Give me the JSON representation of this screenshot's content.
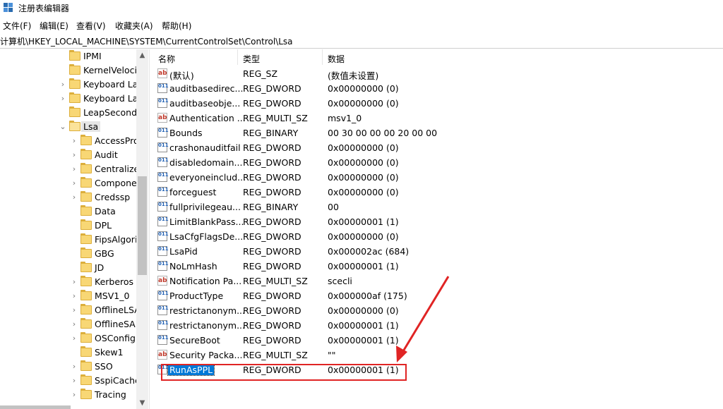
{
  "window": {
    "title": "注册表编辑器"
  },
  "menu": [
    "文件(F)",
    "编辑(E)",
    "查看(V)",
    "收藏夹(A)",
    "帮助(H)"
  ],
  "address": "计算机\\HKEY_LOCAL_MACHINE\\SYSTEM\\CurrentControlSet\\Control\\Lsa",
  "tree": {
    "items": [
      {
        "label": "IPMI",
        "level": 1,
        "expander": "",
        "selected": false
      },
      {
        "label": "KernelVelocit",
        "level": 1,
        "expander": "",
        "selected": false
      },
      {
        "label": "Keyboard Lay",
        "level": 1,
        "expander": ">",
        "selected": false
      },
      {
        "label": "Keyboard Lay",
        "level": 1,
        "expander": ">",
        "selected": false
      },
      {
        "label": "LeapSecondI",
        "level": 1,
        "expander": "",
        "selected": false
      },
      {
        "label": "Lsa",
        "level": 1,
        "expander": "v",
        "selected": true
      },
      {
        "label": "AccessPro",
        "level": 2,
        "expander": ">",
        "selected": false
      },
      {
        "label": "Audit",
        "level": 2,
        "expander": ">",
        "selected": false
      },
      {
        "label": "Centralize",
        "level": 2,
        "expander": ">",
        "selected": false
      },
      {
        "label": "Componer",
        "level": 2,
        "expander": ">",
        "selected": false
      },
      {
        "label": "Credssp",
        "level": 2,
        "expander": ">",
        "selected": false
      },
      {
        "label": "Data",
        "level": 2,
        "expander": "",
        "selected": false
      },
      {
        "label": "DPL",
        "level": 2,
        "expander": "",
        "selected": false
      },
      {
        "label": "FipsAlgori",
        "level": 2,
        "expander": "",
        "selected": false
      },
      {
        "label": "GBG",
        "level": 2,
        "expander": "",
        "selected": false
      },
      {
        "label": "JD",
        "level": 2,
        "expander": "",
        "selected": false
      },
      {
        "label": "Kerberos",
        "level": 2,
        "expander": ">",
        "selected": false
      },
      {
        "label": "MSV1_0",
        "level": 2,
        "expander": ">",
        "selected": false
      },
      {
        "label": "OfflineLSA",
        "level": 2,
        "expander": ">",
        "selected": false
      },
      {
        "label": "OfflineSAM",
        "level": 2,
        "expander": ">",
        "selected": false
      },
      {
        "label": "OSConfig",
        "level": 2,
        "expander": ">",
        "selected": false
      },
      {
        "label": "Skew1",
        "level": 2,
        "expander": "",
        "selected": false
      },
      {
        "label": "SSO",
        "level": 2,
        "expander": ">",
        "selected": false
      },
      {
        "label": "SspiCache",
        "level": 2,
        "expander": ">",
        "selected": false
      },
      {
        "label": "Tracing",
        "level": 2,
        "expander": ">",
        "selected": false
      }
    ]
  },
  "list": {
    "columns": [
      "名称",
      "类型",
      "数据"
    ],
    "rows": [
      {
        "name": "(默认)",
        "type": "REG_SZ",
        "data": "(数值未设置)",
        "icon": "string-value-icon"
      },
      {
        "name": "auditbasedirec...",
        "type": "REG_DWORD",
        "data": "0x00000000 (0)",
        "icon": "binary-value-icon"
      },
      {
        "name": "auditbaseobje...",
        "type": "REG_DWORD",
        "data": "0x00000000 (0)",
        "icon": "binary-value-icon"
      },
      {
        "name": "Authentication ...",
        "type": "REG_MULTI_SZ",
        "data": "msv1_0",
        "icon": "string-value-icon"
      },
      {
        "name": "Bounds",
        "type": "REG_BINARY",
        "data": "00 30 00 00 00 20 00 00",
        "icon": "binary-value-icon"
      },
      {
        "name": "crashonauditfail",
        "type": "REG_DWORD",
        "data": "0x00000000 (0)",
        "icon": "binary-value-icon"
      },
      {
        "name": "disabledomain...",
        "type": "REG_DWORD",
        "data": "0x00000000 (0)",
        "icon": "binary-value-icon"
      },
      {
        "name": "everyoneinclud...",
        "type": "REG_DWORD",
        "data": "0x00000000 (0)",
        "icon": "binary-value-icon"
      },
      {
        "name": "forceguest",
        "type": "REG_DWORD",
        "data": "0x00000000 (0)",
        "icon": "binary-value-icon"
      },
      {
        "name": "fullprivilegeau...",
        "type": "REG_BINARY",
        "data": "00",
        "icon": "binary-value-icon"
      },
      {
        "name": "LimitBlankPass...",
        "type": "REG_DWORD",
        "data": "0x00000001 (1)",
        "icon": "binary-value-icon"
      },
      {
        "name": "LsaCfgFlagsDe...",
        "type": "REG_DWORD",
        "data": "0x00000000 (0)",
        "icon": "binary-value-icon"
      },
      {
        "name": "LsaPid",
        "type": "REG_DWORD",
        "data": "0x000002ac (684)",
        "icon": "binary-value-icon"
      },
      {
        "name": "NoLmHash",
        "type": "REG_DWORD",
        "data": "0x00000001 (1)",
        "icon": "binary-value-icon"
      },
      {
        "name": "Notification Pa...",
        "type": "REG_MULTI_SZ",
        "data": "scecli",
        "icon": "string-value-icon"
      },
      {
        "name": "ProductType",
        "type": "REG_DWORD",
        "data": "0x000000af (175)",
        "icon": "binary-value-icon"
      },
      {
        "name": "restrictanonym...",
        "type": "REG_DWORD",
        "data": "0x00000000 (0)",
        "icon": "binary-value-icon"
      },
      {
        "name": "restrictanonym...",
        "type": "REG_DWORD",
        "data": "0x00000001 (1)",
        "icon": "binary-value-icon"
      },
      {
        "name": "SecureBoot",
        "type": "REG_DWORD",
        "data": "0x00000001 (1)",
        "icon": "binary-value-icon"
      },
      {
        "name": "Security Packa...",
        "type": "REG_MULTI_SZ",
        "data": "\"\"",
        "icon": "string-value-icon"
      },
      {
        "name": "RunAsPPL",
        "type": "REG_DWORD",
        "data": "0x00000001 (1)",
        "icon": "binary-value-icon",
        "selected": true
      }
    ]
  },
  "colors": {
    "selection": "#0078d7",
    "annotation": "#e02424",
    "folder": "#f8d775"
  }
}
